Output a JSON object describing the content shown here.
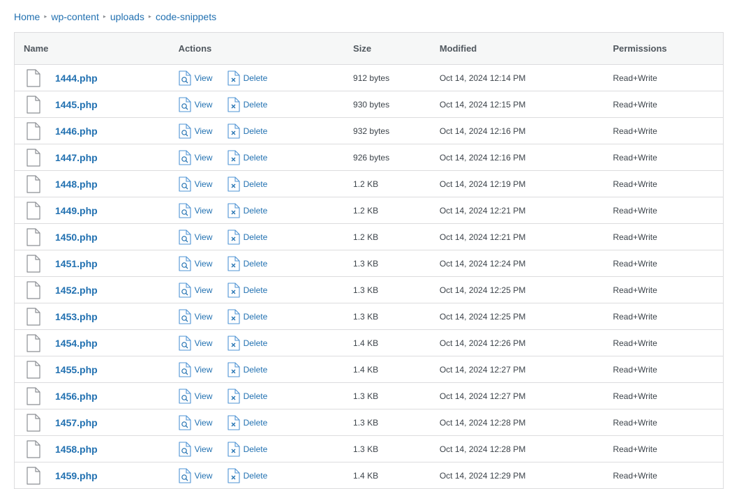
{
  "breadcrumb": [
    "Home",
    "wp-content",
    "uploads",
    "code-snippets"
  ],
  "table": {
    "headers": {
      "name": "Name",
      "actions": "Actions",
      "size": "Size",
      "modified": "Modified",
      "permissions": "Permissions"
    },
    "view_label": "View",
    "delete_label": "Delete",
    "rows": [
      {
        "name": "1444.php",
        "size": "912 bytes",
        "modified": "Oct 14, 2024 12:14 PM",
        "permissions": "Read+Write"
      },
      {
        "name": "1445.php",
        "size": "930 bytes",
        "modified": "Oct 14, 2024 12:15 PM",
        "permissions": "Read+Write"
      },
      {
        "name": "1446.php",
        "size": "932 bytes",
        "modified": "Oct 14, 2024 12:16 PM",
        "permissions": "Read+Write"
      },
      {
        "name": "1447.php",
        "size": "926 bytes",
        "modified": "Oct 14, 2024 12:16 PM",
        "permissions": "Read+Write"
      },
      {
        "name": "1448.php",
        "size": "1.2 KB",
        "modified": "Oct 14, 2024 12:19 PM",
        "permissions": "Read+Write"
      },
      {
        "name": "1449.php",
        "size": "1.2 KB",
        "modified": "Oct 14, 2024 12:21 PM",
        "permissions": "Read+Write"
      },
      {
        "name": "1450.php",
        "size": "1.2 KB",
        "modified": "Oct 14, 2024 12:21 PM",
        "permissions": "Read+Write"
      },
      {
        "name": "1451.php",
        "size": "1.3 KB",
        "modified": "Oct 14, 2024 12:24 PM",
        "permissions": "Read+Write"
      },
      {
        "name": "1452.php",
        "size": "1.3 KB",
        "modified": "Oct 14, 2024 12:25 PM",
        "permissions": "Read+Write"
      },
      {
        "name": "1453.php",
        "size": "1.3 KB",
        "modified": "Oct 14, 2024 12:25 PM",
        "permissions": "Read+Write"
      },
      {
        "name": "1454.php",
        "size": "1.4 KB",
        "modified": "Oct 14, 2024 12:26 PM",
        "permissions": "Read+Write"
      },
      {
        "name": "1455.php",
        "size": "1.4 KB",
        "modified": "Oct 14, 2024 12:27 PM",
        "permissions": "Read+Write"
      },
      {
        "name": "1456.php",
        "size": "1.3 KB",
        "modified": "Oct 14, 2024 12:27 PM",
        "permissions": "Read+Write"
      },
      {
        "name": "1457.php",
        "size": "1.3 KB",
        "modified": "Oct 14, 2024 12:28 PM",
        "permissions": "Read+Write"
      },
      {
        "name": "1458.php",
        "size": "1.3 KB",
        "modified": "Oct 14, 2024 12:28 PM",
        "permissions": "Read+Write"
      },
      {
        "name": "1459.php",
        "size": "1.4 KB",
        "modified": "Oct 14, 2024 12:29 PM",
        "permissions": "Read+Write"
      }
    ]
  },
  "icons": {
    "file": "file-icon",
    "view": "view-file-icon",
    "delete": "delete-file-icon"
  },
  "colors": {
    "link": "#2271b1",
    "header_bg": "#f6f7f7",
    "border": "#dcdcde"
  }
}
